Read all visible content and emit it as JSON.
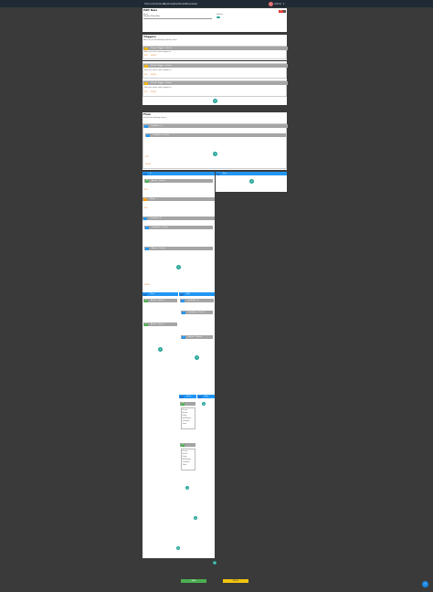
{
  "nav": {
    "items": [
      "Home",
      "Controllers",
      "Pipelines",
      "Dashboard",
      "Developer"
    ],
    "user": "Admin"
  },
  "page": {
    "title": "Edit Rule",
    "name_label": "Name",
    "name_value": "Kitchen Door Rule",
    "enabled_label": "Enabled"
  },
  "triggers": {
    "title": "Triggers",
    "subtitle": "When any of the following conditions occur:",
    "items": [
      {
        "head": "Device Trigger - Device",
        "body": "When the device state changes to:"
      },
      {
        "head": "Device Trigger - Sensor",
        "body": "When the sensor value changes to:"
      },
      {
        "head": "Device Trigger - Sensor",
        "body": "When the sensor value changes to:"
      }
    ]
  },
  "flow": {
    "title": "Flow",
    "subtitle": "Execute the following actions:",
    "top_block": "Condition - If",
    "top_block_sub": "Condition - Device",
    "if_label": "If",
    "else_label": "Else",
    "then_label": "Then",
    "action_device": "Action - Device",
    "action_delay": "Delay",
    "action_notify": "Notification",
    "action_sensor": "Action - Sensor"
  },
  "menu": {
    "options": [
      "Device",
      "Sensor",
      "Delay",
      "Notification",
      "Condition",
      "Timer"
    ]
  },
  "links": {
    "edit": "EDIT",
    "delete": "DELETE"
  },
  "footer": {
    "save": "SAVE",
    "cancel": "CANCEL"
  },
  "colors": {
    "accent": "#26a69a",
    "trigger_bar": "#a5a5a5",
    "trigger_icon": "#f0b400",
    "flow_blue": "#2196f3",
    "save": "#4caf50",
    "cancel": "#f1c40f",
    "delete": "#e53935"
  }
}
